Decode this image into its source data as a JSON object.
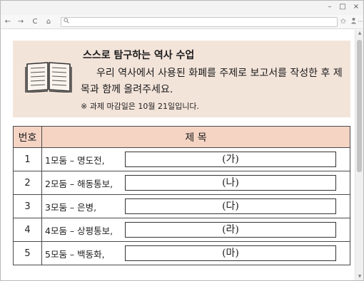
{
  "window": {
    "controls": {
      "minimize": "–",
      "maximize": "□",
      "close": "×"
    }
  },
  "toolbar": {
    "back": "←",
    "forward": "→",
    "reload": "C",
    "home": "⌂",
    "search_glyph": "🔍︎",
    "url_value": "",
    "favorite": "✩",
    "profile": "👤︎",
    "menu": "···"
  },
  "notice": {
    "title": "스스로 탐구하는 역사 수업",
    "body": "우리 역사에서 사용된 화폐를 주제로 보고서를 작성한 후 제목과 함께 올려주세요.",
    "note": "※ 과제 마감일은 10월 21일입니다."
  },
  "table": {
    "headers": {
      "number": "번호",
      "title": "제 목"
    },
    "rows": [
      {
        "number": "1",
        "group": "1모둠 – 명도전,",
        "answer": "(가)"
      },
      {
        "number": "2",
        "group": "2모둠 – 해동통보,",
        "answer": "(나)"
      },
      {
        "number": "3",
        "group": "3모둠 – 은병,",
        "answer": "(다)"
      },
      {
        "number": "4",
        "group": "4모둠 – 상평통보,",
        "answer": "(라)"
      },
      {
        "number": "5",
        "group": "5모둠 – 백동화,",
        "answer": "(마)"
      }
    ]
  },
  "colors": {
    "notice_bg": "#f3e4da",
    "header_bg": "#f5d4c4"
  },
  "icons": [
    "book-icon",
    "search-icon",
    "favorite-icon",
    "profile-icon",
    "menu-icon"
  ]
}
